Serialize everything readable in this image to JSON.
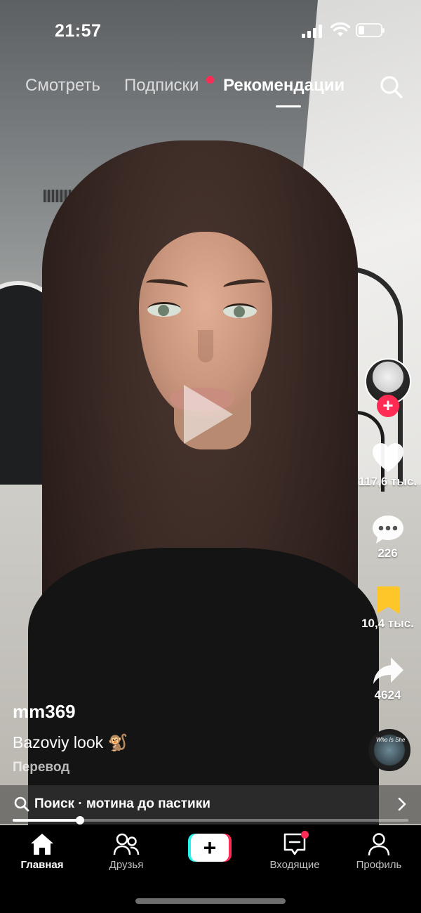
{
  "status_bar": {
    "time": "21:57"
  },
  "top_tabs": [
    {
      "label": "Смотреть",
      "active": false
    },
    {
      "label": "Подписки",
      "active": false,
      "has_dot": true
    },
    {
      "label": "Рекомендации",
      "active": true
    }
  ],
  "actions": {
    "likes": "117,6 тыс.",
    "comments": "226",
    "saves": "10,4 тыс.",
    "shares": "4624"
  },
  "music_disc_text": "Who Is She",
  "post": {
    "username": "mm369",
    "caption": "Bazoviy look 🐒",
    "translate_label": "Перевод"
  },
  "search_suggestion": "Поиск · мотина до пастики",
  "video_progress": 0.17,
  "bottom_nav": [
    {
      "label": "Главная",
      "icon": "home-icon",
      "active": true
    },
    {
      "label": "Друзья",
      "icon": "friends-icon",
      "active": false
    },
    {
      "label": "",
      "icon": "create-icon",
      "active": false
    },
    {
      "label": "Входящие",
      "icon": "inbox-icon",
      "active": false,
      "has_dot": true
    },
    {
      "label": "Профиль",
      "icon": "profile-icon",
      "active": false
    }
  ],
  "colors": {
    "accent": "#fe2c55",
    "cyan": "#25f4ee",
    "save_yellow": "#ffc629"
  }
}
